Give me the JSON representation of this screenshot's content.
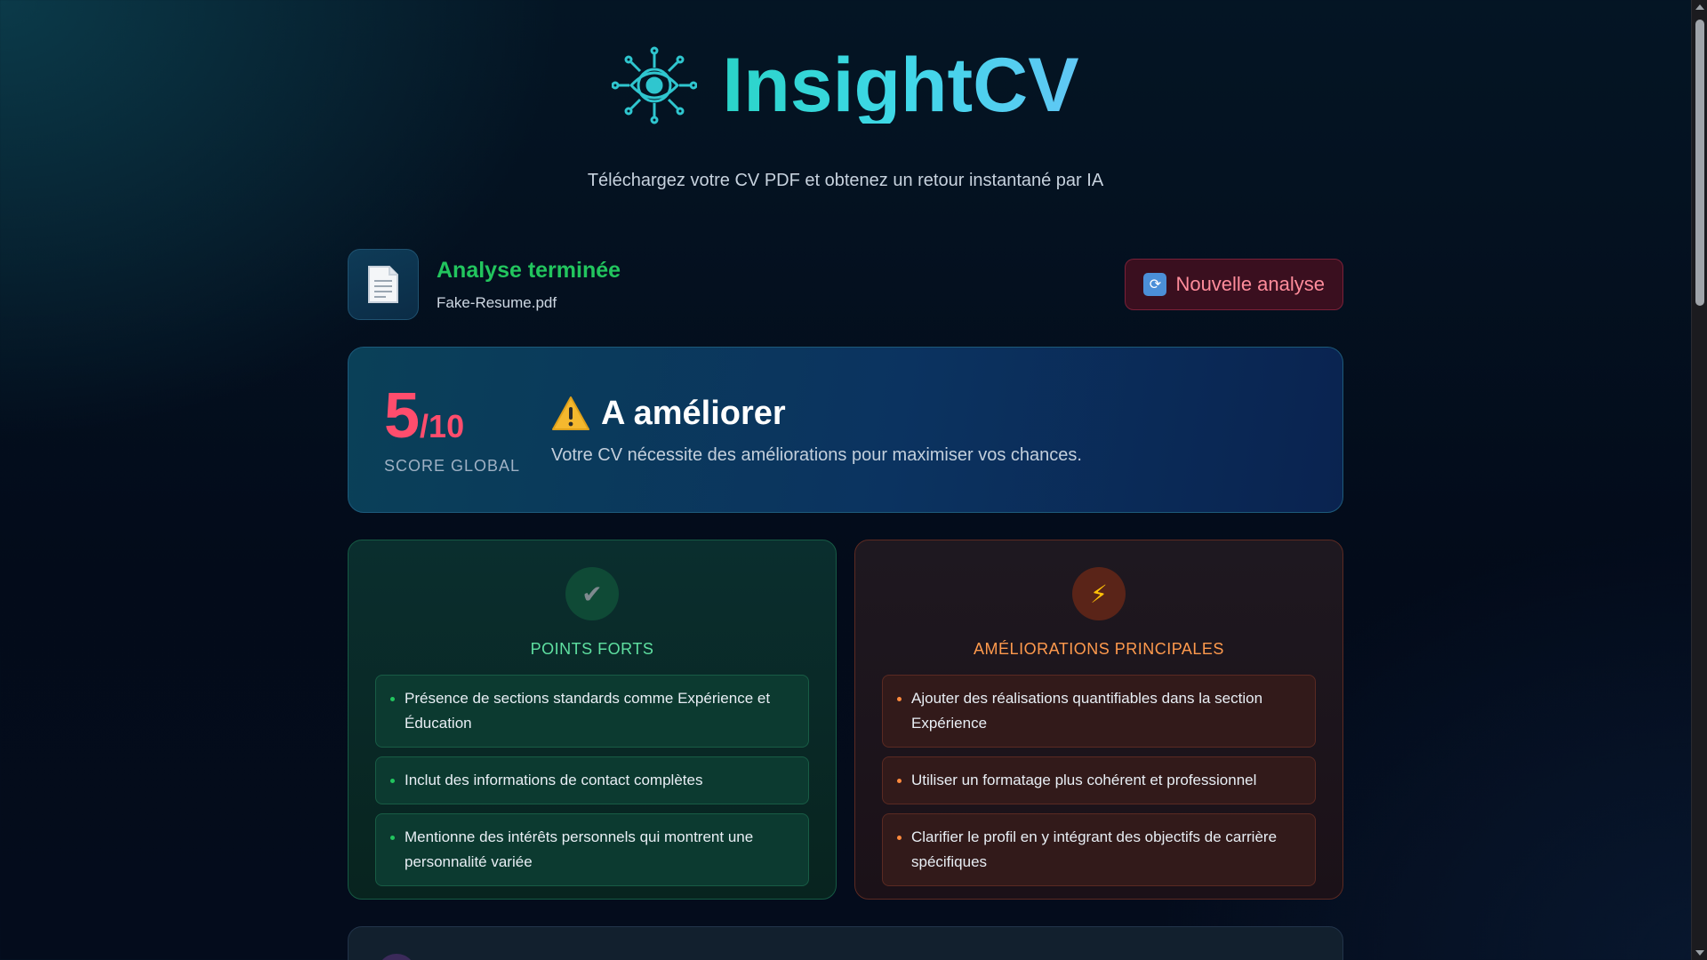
{
  "header": {
    "title": "InsightCV",
    "logo_icon": "eye-circuit-icon",
    "subtitle": "Téléchargez votre CV PDF et obtenez un retour instantané par IA"
  },
  "file": {
    "status": "Analyse terminée",
    "name": "Fake-Resume.pdf",
    "icon": "document-icon",
    "new_button": "Nouvelle analyse",
    "new_button_icon": "refresh-icon"
  },
  "score": {
    "value": "5",
    "max": "/10",
    "label": "SCORE GLOBAL",
    "verdict": "A améliorer",
    "verdict_icon": "warning-icon",
    "description": "Votre CV nécessite des améliorations pour maximiser vos chances."
  },
  "strengths": {
    "title": "POINTS FORTS",
    "icon": "check-icon",
    "items": [
      "Présence de sections standards comme Expérience et Éducation",
      "Inclut des informations de contact complètes",
      "Mentionne des intérêts personnels qui montrent une personnalité variée"
    ]
  },
  "improvements": {
    "title": "AMÉLIORATIONS PRINCIPALES",
    "icon": "lightning-icon",
    "items": [
      "Ajouter des réalisations quantifiables dans la section Expérience",
      "Utiliser un formatage plus cohérent et professionnel",
      "Clarifier le profil en y intégrant des objectifs de carrière spécifiques"
    ]
  },
  "colors": {
    "accent": "#2ad4c8",
    "success": "#22c55e",
    "danger": "#ff4d6d",
    "warning": "#ff9a4d"
  }
}
